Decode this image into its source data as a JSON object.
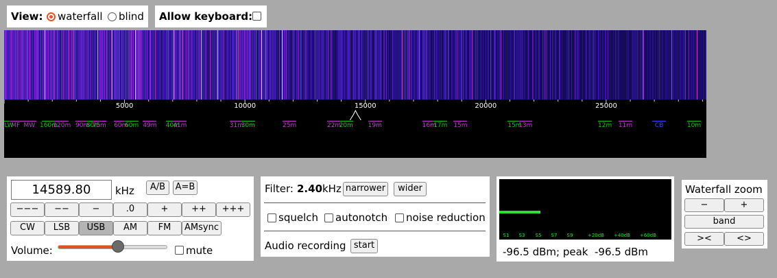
{
  "view": {
    "label": "View:",
    "options": [
      "waterfall",
      "blind"
    ],
    "selected": "waterfall"
  },
  "keyboard": {
    "label": "Allow keyboard:",
    "checked": false
  },
  "scale": {
    "max_hz": 29160,
    "ticks": [
      "5000",
      "10000",
      "15000",
      "20000",
      "25000"
    ],
    "tick_values": [
      5000,
      10000,
      15000,
      20000,
      25000
    ],
    "tuned_hz": 14589.8,
    "bands": [
      {
        "name": "LW",
        "hz": 200,
        "color": "#1fbf1f"
      },
      {
        "name": "MF",
        "hz": 480,
        "color": "#c03cd0"
      },
      {
        "name": "MW",
        "hz": 1050,
        "color": "#c03cd0"
      },
      {
        "name": "160m",
        "hz": 1850,
        "color": "#1fbf1f"
      },
      {
        "name": "120m",
        "hz": 2400,
        "color": "#c03cd0"
      },
      {
        "name": "90m",
        "hz": 3250,
        "color": "#c03cd0"
      },
      {
        "name": "80m",
        "hz": 3700,
        "color": "#1fbf1f"
      },
      {
        "name": "75m",
        "hz": 3950,
        "color": "#c03cd0"
      },
      {
        "name": "60m",
        "hz": 4850,
        "color": "#c03cd0"
      },
      {
        "name": "60m",
        "hz": 5300,
        "color": "#1fbf1f"
      },
      {
        "name": "49m",
        "hz": 6050,
        "color": "#c03cd0"
      },
      {
        "name": "40m",
        "hz": 7000,
        "color": "#1fbf1f"
      },
      {
        "name": "41m",
        "hz": 7300,
        "color": "#c03cd0"
      },
      {
        "name": "31m",
        "hz": 9650,
        "color": "#c03cd0"
      },
      {
        "name": "30m",
        "hz": 10130,
        "color": "#1fbf1f"
      },
      {
        "name": "25m",
        "hz": 11850,
        "color": "#c03cd0"
      },
      {
        "name": "22m",
        "hz": 13700,
        "color": "#c03cd0"
      },
      {
        "name": "20m",
        "hz": 14200,
        "color": "#1fbf1f"
      },
      {
        "name": "19m",
        "hz": 15400,
        "color": "#c03cd0"
      },
      {
        "name": "16m",
        "hz": 17650,
        "color": "#c03cd0"
      },
      {
        "name": "17m",
        "hz": 18120,
        "color": "#1fbf1f"
      },
      {
        "name": "15m",
        "hz": 18950,
        "color": "#c03cd0"
      },
      {
        "name": "15m",
        "hz": 21200,
        "color": "#1fbf1f"
      },
      {
        "name": "13m",
        "hz": 21650,
        "color": "#c03cd0"
      },
      {
        "name": "12m",
        "hz": 24950,
        "color": "#1fbf1f"
      },
      {
        "name": "11m",
        "hz": 25800,
        "color": "#c03cd0"
      },
      {
        "name": "CB",
        "hz": 27200,
        "color": "#3a4bff"
      },
      {
        "name": "10m",
        "hz": 28650,
        "color": "#1fbf1f"
      }
    ]
  },
  "tuning": {
    "frequency": "14589.80",
    "unit": "kHz",
    "ab_label": "A/B",
    "aeqb_label": "A=B",
    "step_buttons": [
      "−−−",
      "−−",
      "−",
      ".0",
      "+",
      "++",
      "+++"
    ],
    "modes": [
      "CW",
      "LSB",
      "USB",
      "AM",
      "FM",
      "AMsync"
    ],
    "selected_mode": "USB",
    "volume_label": "Volume:",
    "volume_level": 0.55,
    "mute_label": "mute",
    "mute_checked": false
  },
  "filter": {
    "label": "Filter:",
    "bandwidth": "2.40",
    "unit": "kHz",
    "narrower_label": "narrower",
    "wider_label": "wider",
    "options": [
      "squelch",
      "autonotch",
      "noise reduction"
    ],
    "audio_recording_label": "Audio recording",
    "start_label": "start"
  },
  "smeter": {
    "scale_labels": [
      "S1",
      "S3",
      "S5",
      "S7",
      "S9",
      "+20dB",
      "+40dB",
      "+60dB"
    ],
    "level_fraction": 0.24,
    "reading": "-96.5 dBm; peak  -96.5 dBm",
    "bar_color": "#2ee02e"
  },
  "zoom": {
    "title": "Waterfall zoom",
    "minus_label": "−",
    "plus_label": "+",
    "band_label": "band",
    "left_label": "><",
    "right_label": "<>"
  }
}
